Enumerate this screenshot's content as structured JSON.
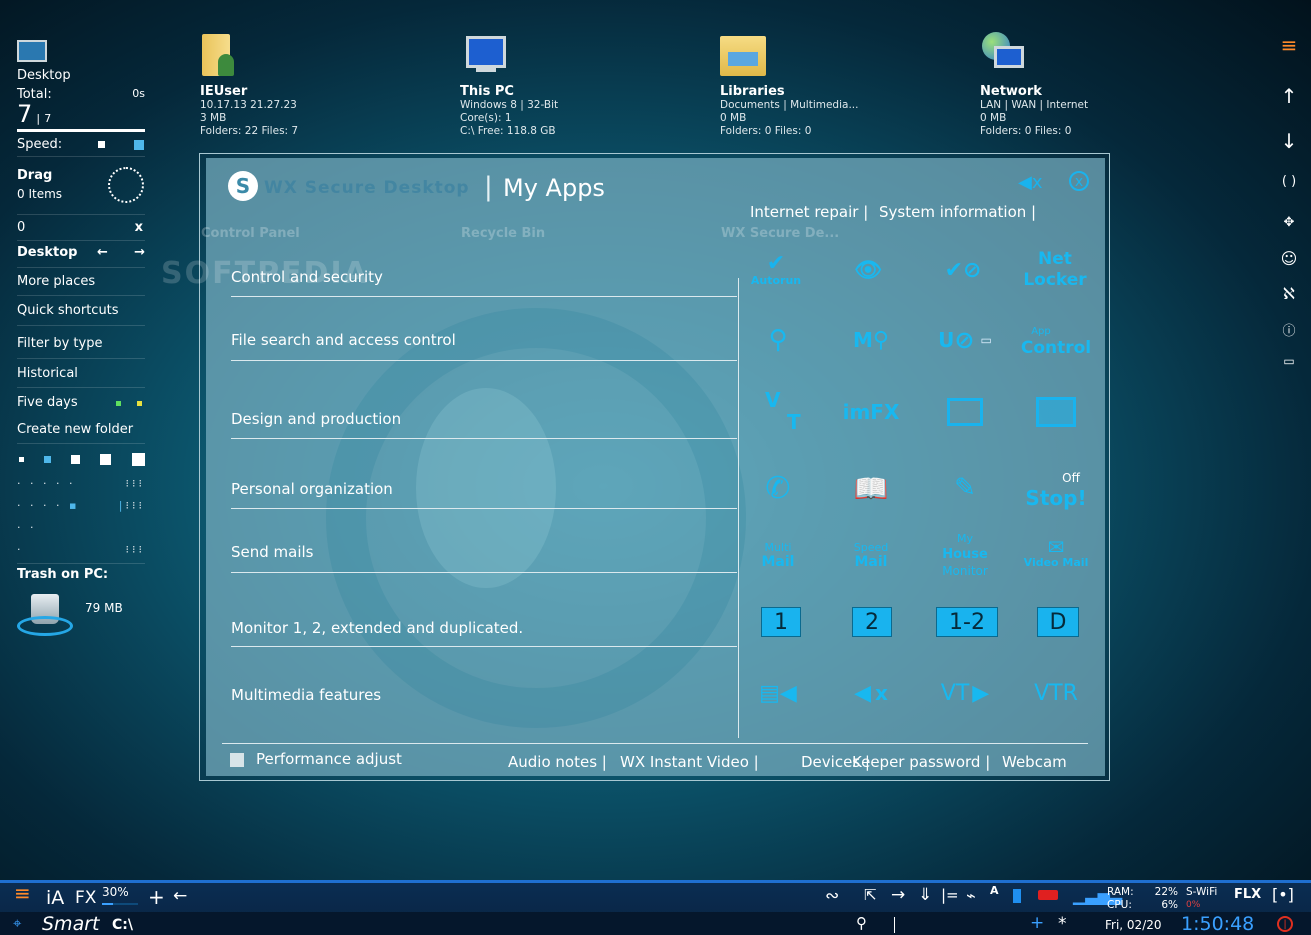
{
  "sidebar": {
    "desktop_label": "Desktop",
    "total_label": "Total:",
    "total_time": "0s",
    "count_big": "7",
    "count_sep": "|",
    "count_small": "7",
    "speed_label": "Speed:",
    "drag_label": "Drag",
    "drag_items": "0 Items",
    "zero_value": "0",
    "close_x": "x",
    "nav_desktop": "Desktop",
    "more_places": "More places",
    "quick_shortcuts": "Quick shortcuts",
    "filter_by_type": "Filter by type",
    "historical": "Historical",
    "five_days": "Five days",
    "create_new_folder": "Create new folder",
    "trash_label": "Trash on PC:",
    "trash_size": "79 MB"
  },
  "desktop_icons": [
    {
      "name": "IEUser",
      "line1": "10.17.13  21.27.23",
      "line2": "3 MB",
      "line3": "Folders: 22  Files: 7"
    },
    {
      "name": "This PC",
      "line1": "Windows 8 | 32-Bit",
      "line2": "Core(s): 1",
      "line3": "C:\\  Free: 118.8 GB"
    },
    {
      "name": "Libraries",
      "line1": "Documents | Multimedia...",
      "line2": "0 MB",
      "line3": "Folders: 0  Files: 0"
    },
    {
      "name": "Network",
      "line1": "LAN | WAN | Internet",
      "line2": "0 MB",
      "line3": "Folders: 0  Files: 0"
    }
  ],
  "ghost_icons": {
    "a": "Control Panel",
    "b": "Recycle Bin",
    "c": "WX Secure De...",
    "watermark": "SOFTPEDIA"
  },
  "panel": {
    "brand": "WX Secure Desktop",
    "separator": "|",
    "title": "My Apps",
    "top_links": [
      "Internet repair |",
      "System information |"
    ],
    "categories": [
      "Control and security",
      "File search and access control",
      "Design and production",
      "Personal organization",
      "Send mails",
      "Monitor 1, 2, extended and duplicated.",
      "Multimedia features"
    ],
    "tiles": {
      "autorun": "Autorun",
      "net": "Net",
      "locker": "Locker",
      "m_search": "M",
      "u_block": "U",
      "app": "App",
      "control": "Control",
      "v": "V",
      "t": "T",
      "imfx": "imFX",
      "off": "Off",
      "stop": "Stop!",
      "multi": "Multi",
      "mail": "Mail",
      "speed": "Speed",
      "my": "My",
      "house": "House",
      "monitor": "Monitor",
      "video_mail": "Video Mail",
      "vt": "VT",
      "vtr": "VTR",
      "mute_x": "x"
    },
    "monitor_buttons": [
      "1",
      "2",
      "1-2",
      "D"
    ],
    "performance_adjust": "Performance adjust",
    "bottom_links": [
      "Audio notes |",
      "WX Instant Video |",
      "Devices |",
      "Keeper password |",
      "Webcam"
    ]
  },
  "taskbar": {
    "ia": "iA",
    "fx": "FX",
    "fx_percent": "30%",
    "fx_level": 0.3,
    "plus": "+",
    "back": "←",
    "smart": "Smart",
    "drive": "C:\\",
    "ram_label": "RAM:",
    "ram_value": "22%",
    "cpu_label": "CPU:",
    "cpu_value": "6%",
    "wifi": "S-WiFi",
    "wifi_status": "0%",
    "flx": "FLX",
    "date": "Fri, 02/20",
    "time": "1:50:48"
  },
  "colors": {
    "accent": "#19b3ee",
    "taskbar": "#0b2d52",
    "taskbar_border": "#1f6fd0"
  }
}
